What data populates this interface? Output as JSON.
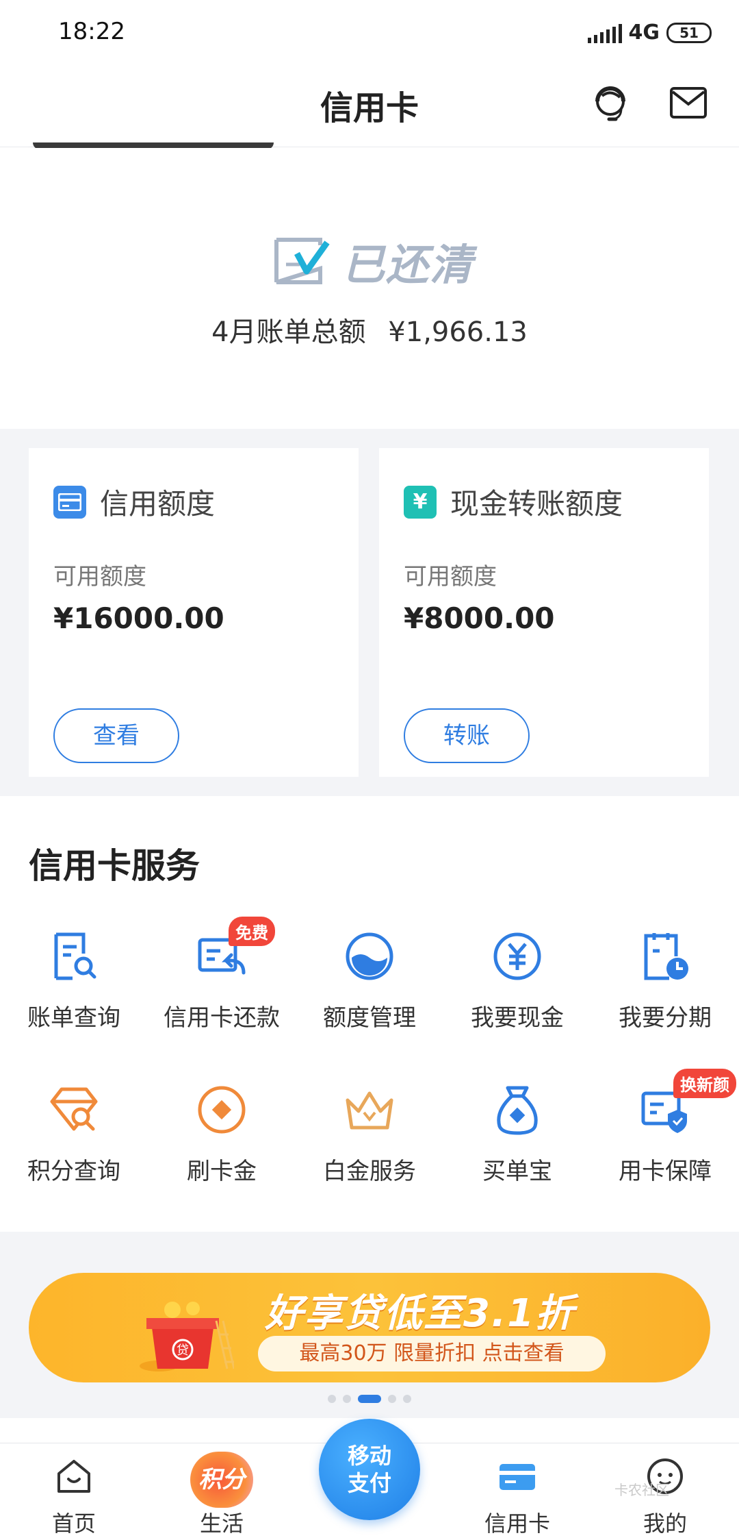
{
  "status_bar": {
    "time": "18:22",
    "network": "4G",
    "battery": "51"
  },
  "header": {
    "title": "信用卡"
  },
  "bill": {
    "status": "已还清",
    "total_label": "4月账单总额",
    "total_amount": "¥1,966.13"
  },
  "limits": [
    {
      "title": "信用额度",
      "sub_label": "可用额度",
      "amount": "¥16000.00",
      "button": "查看",
      "accent": "#3c8be8"
    },
    {
      "title": "现金转账额度",
      "sub_label": "可用额度",
      "amount": "¥8000.00",
      "button": "转账",
      "accent": "#1fc0b4"
    }
  ],
  "services": {
    "title": "信用卡服务",
    "items": [
      {
        "label": "账单查询",
        "icon": "bill-search-icon"
      },
      {
        "label": "信用卡还款",
        "icon": "repay-icon",
        "badge": "免费"
      },
      {
        "label": "额度管理",
        "icon": "limit-gauge-icon"
      },
      {
        "label": "我要现金",
        "icon": "cash-icon"
      },
      {
        "label": "我要分期",
        "icon": "installment-icon"
      },
      {
        "label": "积分查询",
        "icon": "points-search-icon"
      },
      {
        "label": "刷卡金",
        "icon": "card-bonus-icon"
      },
      {
        "label": "白金服务",
        "icon": "crown-icon"
      },
      {
        "label": "买单宝",
        "icon": "money-bag-icon"
      },
      {
        "label": "用卡保障",
        "icon": "card-shield-icon",
        "badge": "换新颜"
      }
    ]
  },
  "banner": {
    "headline": "好享贷低至3.1折",
    "subline": "最高30万 限量折扣 点击查看",
    "gift_label": "贷"
  },
  "tabbar": {
    "items": [
      {
        "label": "首页",
        "icon": "home-icon"
      },
      {
        "label": "生活",
        "icon": "life-points-icon",
        "badge": "积分"
      },
      {
        "label": "移动支付",
        "icon": "mobile-pay-icon"
      },
      {
        "label": "信用卡",
        "icon": "credit-card-icon"
      },
      {
        "label": "我的",
        "icon": "profile-icon"
      }
    ],
    "center_line1": "移动",
    "center_line2": "支付",
    "watermark": "卡农社区"
  },
  "colors": {
    "primary": "#2f7de1",
    "orange": "#f08a3a",
    "badge_red": "#f1463a",
    "banner": "#fcc23a"
  }
}
